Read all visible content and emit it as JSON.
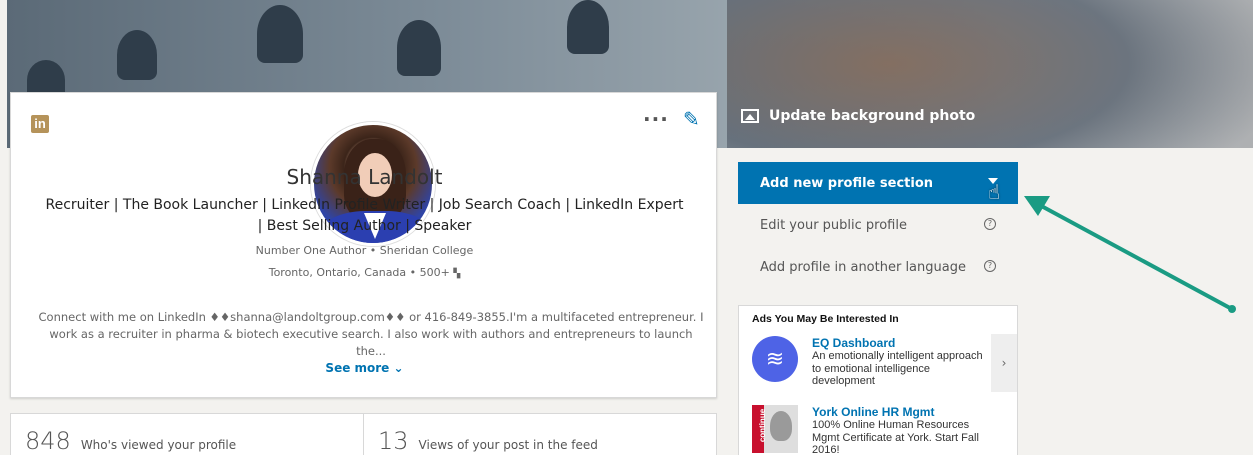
{
  "banner": {
    "update_background_label": "Update background photo"
  },
  "profile": {
    "name": "Shanna Landolt",
    "headline": "Recruiter | The Book Launcher | LinkedIn Profile Writer | Job Search Coach | LinkedIn Expert | Best Selling Author | Speaker",
    "education_line": "Number One Author • Sheridan College",
    "location_line": "Toronto, Ontario, Canada • 500+",
    "summary": "Connect with me on LinkedIn ♦♦shanna@landoltgroup.com♦♦ or 416-849-3855.I'm a multifaceted entrepreneur. I work as a recruiter in pharma & biotech executive search. I also work with authors and entrepreneurs to launch the...",
    "see_more_label": "See more",
    "more_actions": "···",
    "logo_text": "in"
  },
  "stats": [
    {
      "count": "848",
      "label": "Who's viewed your profile"
    },
    {
      "count": "13",
      "label": "Views of your post in the feed"
    }
  ],
  "right_panel": {
    "add_section_label": "Add new profile section",
    "edit_public_label": "Edit your public profile",
    "add_language_label": "Add profile in another language"
  },
  "ads": {
    "title": "Ads You May Be Interested In",
    "items": [
      {
        "title": "EQ Dashboard",
        "description": "An emotionally intelligent approach to emotional intelligence development"
      },
      {
        "title": "York Online HR Mgmt",
        "description": "100% Online Human Resources Mgmt Certificate at York. Start Fall 2016!",
        "thumb_text": "continue"
      }
    ],
    "next_label": "›"
  },
  "colors": {
    "accent": "#0073b1",
    "logo": "#b5935a",
    "arrow": "#1a9b83"
  }
}
